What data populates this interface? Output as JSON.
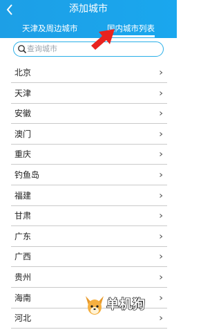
{
  "header": {
    "title": "添加城市",
    "background": "#1d9fe6"
  },
  "tabs": [
    {
      "label": "天津及周边城市",
      "active": false
    },
    {
      "label": "国内城市列表",
      "active": true
    }
  ],
  "search": {
    "placeholder": "查询城市"
  },
  "cities": [
    "北京",
    "天津",
    "安徽",
    "澳门",
    "重庆",
    "钓鱼岛",
    "福建",
    "甘肃",
    "广东",
    "广西",
    "贵州",
    "海南",
    "河北"
  ],
  "icons": {
    "back": "chevron-left-icon",
    "search": "search-icon",
    "row": "chevron-right-icon"
  },
  "annotation": {
    "arrow_color": "#e8231f"
  },
  "watermark": {
    "text": "单机狗"
  }
}
